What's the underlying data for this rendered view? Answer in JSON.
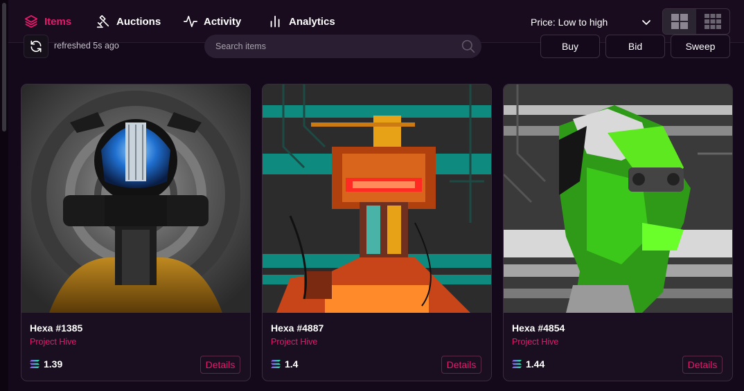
{
  "nav": {
    "tabs": [
      {
        "label": "Items",
        "icon": "layers-icon",
        "active": true
      },
      {
        "label": "Auctions",
        "icon": "gavel-icon",
        "active": false
      },
      {
        "label": "Activity",
        "icon": "activity-icon",
        "active": false
      },
      {
        "label": "Analytics",
        "icon": "bar-chart-icon",
        "active": false
      }
    ],
    "sort_label": "Price: Low to high"
  },
  "toolbar": {
    "refresh_text": "refreshed 5s ago",
    "search_placeholder": "Search items",
    "buy_label": "Buy",
    "bid_label": "Bid",
    "sweep_label": "Sweep"
  },
  "cards": [
    {
      "title": "Hexa #1385",
      "collection": "Project Hive",
      "price": "1.39",
      "details_label": "Details"
    },
    {
      "title": "Hexa #4887",
      "collection": "Project Hive",
      "price": "1.4",
      "details_label": "Details"
    },
    {
      "title": "Hexa #4854",
      "collection": "Project Hive",
      "price": "1.44",
      "details_label": "Details"
    }
  ],
  "colors": {
    "accent": "#e8196d",
    "background": "#14091a",
    "card": "#1a0f20"
  }
}
